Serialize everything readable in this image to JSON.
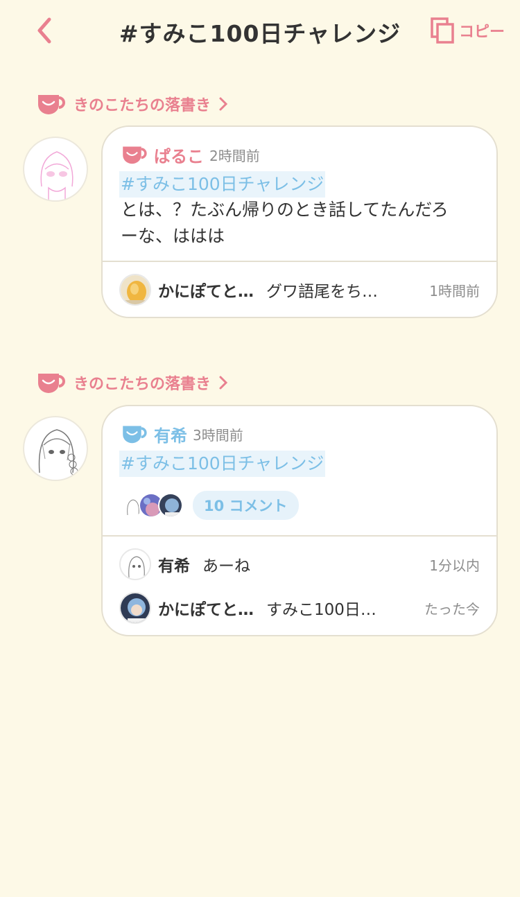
{
  "header": {
    "title": "#すみこ100日チャレンジ",
    "copy_label": "コピー"
  },
  "colors": {
    "accent_pink": "#e9808f",
    "accent_blue": "#7cbfe6",
    "background": "#fdf9e7"
  },
  "posts": [
    {
      "group_label": "きのこたちの落書き",
      "author": "ぱるこ",
      "author_icon": "cup-icon-pink",
      "time": "2時間前",
      "tag": "#すみこ100日チャレンジ",
      "body_line1": "とは、？たぶん帰りのとき話してたんだろ",
      "body_line2": "ーな、ははは",
      "comments": [
        {
          "name": "かにぽてと…",
          "text": "グワ語尾をち…",
          "time": "1時間前"
        }
      ]
    },
    {
      "group_label": "きのこたちの落書き",
      "author": "有希",
      "author_icon": "cup-icon-blue",
      "time": "3時間前",
      "tag": "#すみこ100日チャレンジ",
      "comment_count_label": "10 コメント",
      "comments": [
        {
          "name": "有希",
          "text": "あーね",
          "time": "1分以内"
        },
        {
          "name": "かにぽてと…",
          "text": "すみこ100日…",
          "time": "たった今"
        }
      ]
    }
  ]
}
